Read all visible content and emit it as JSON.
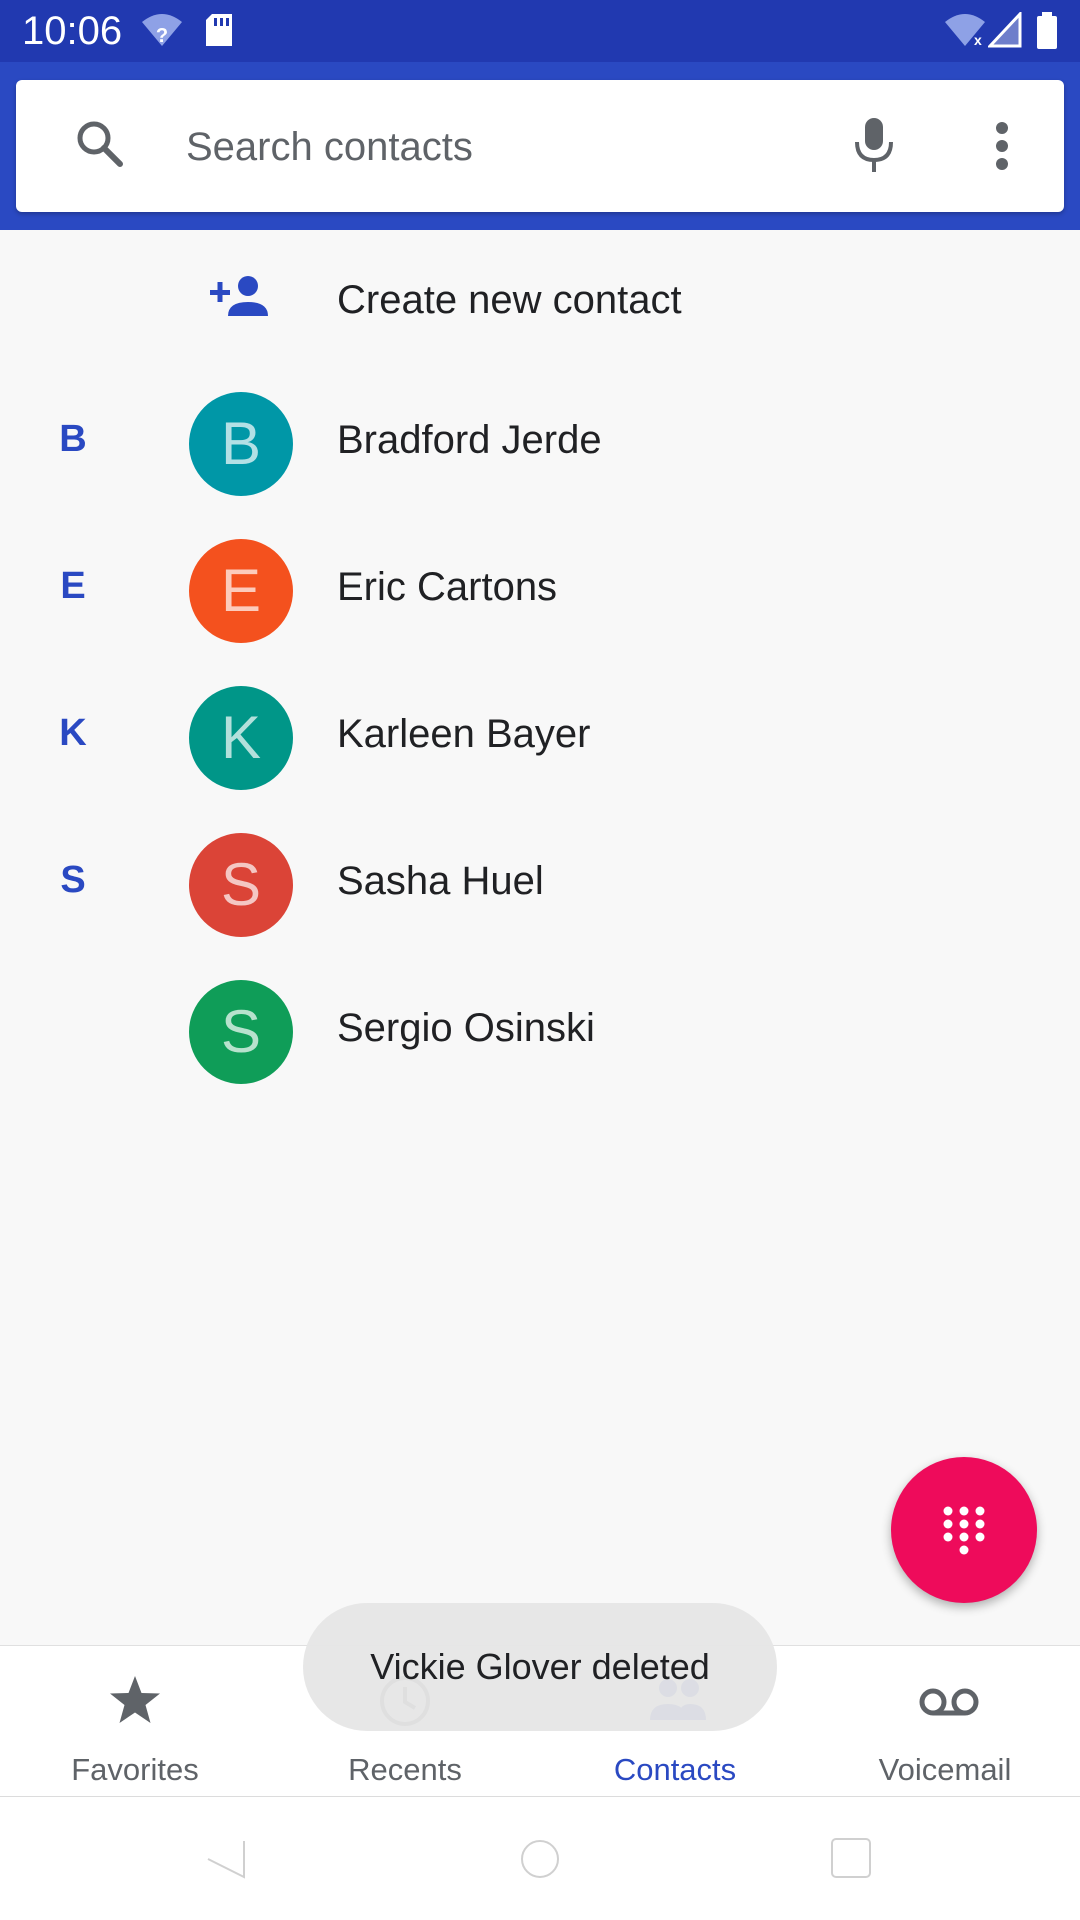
{
  "status_bar": {
    "time": "10:06"
  },
  "search": {
    "placeholder": "Search contacts"
  },
  "create_contact": {
    "label": "Create new contact"
  },
  "contacts": [
    {
      "section_letter": "B",
      "initial": "B",
      "name": "Bradford Jerde",
      "color": "#0097a7"
    },
    {
      "section_letter": "E",
      "initial": "E",
      "name": "Eric Cartons",
      "color": "#f4511e"
    },
    {
      "section_letter": "K",
      "initial": "K",
      "name": "Karleen Bayer",
      "color": "#009688"
    },
    {
      "section_letter": "S",
      "initial": "S",
      "name": "Sasha Huel",
      "color": "#db4437"
    },
    {
      "section_letter": "",
      "initial": "S",
      "name": "Sergio Osinski",
      "color": "#0f9d58"
    }
  ],
  "bottom_nav": {
    "favorites": "Favorites",
    "recents": "Recents",
    "contacts": "Contacts",
    "voicemail": "Voicemail",
    "active": "contacts"
  },
  "toast": {
    "message": "Vickie Glover deleted"
  },
  "colors": {
    "app_bar": "#2a49c2",
    "accent": "#2a49c2",
    "fab": "#ee0b5b"
  },
  "icons": {
    "status": [
      "wifi-unknown-icon",
      "sd-card-icon",
      "wifi-off-icon",
      "cell-signal-icon",
      "battery-icon"
    ],
    "search": "search-icon",
    "mic": "mic-icon",
    "more": "more-vert-icon",
    "create": "person-add-icon",
    "fab": "dialpad-icon",
    "nav": [
      "star-icon",
      "clock-icon",
      "people-icon",
      "voicemail-icon"
    ]
  }
}
